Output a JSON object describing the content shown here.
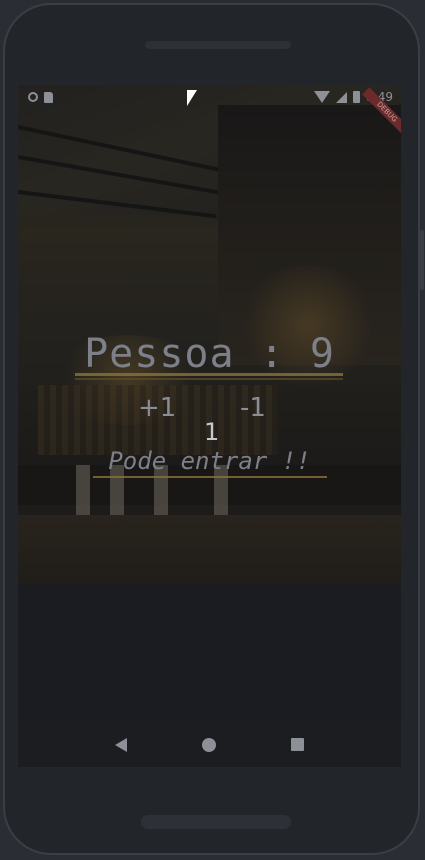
{
  "status_bar": {
    "time": "8:49",
    "icons": [
      "circle-icon",
      "sd-card-icon",
      "wifi-icon",
      "signal-icon",
      "battery-icon"
    ]
  },
  "debug_banner": "DEBUG",
  "app": {
    "title": "Pessoa : 9",
    "increment_label": "+1",
    "decrement_label": "-1",
    "counter_value": "1",
    "status_message": "Pode entrar !!"
  },
  "nav_bar": {
    "icons": [
      "back-icon",
      "home-icon",
      "recents-icon"
    ]
  },
  "colors": {
    "accent_underline": "#8a7338",
    "text_dim": "#7d8088"
  }
}
